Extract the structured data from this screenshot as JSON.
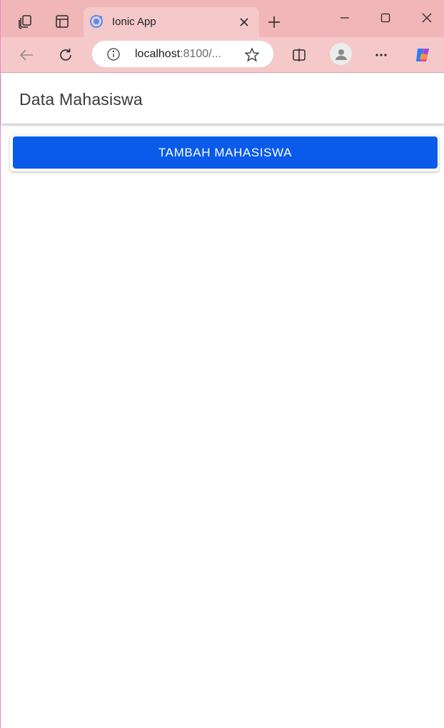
{
  "browser": {
    "tab": {
      "title": "Ionic App"
    },
    "address": {
      "host": "localhost",
      "rest": ":8100/..."
    },
    "icons": {
      "workspaces": "workspaces-icon",
      "tab_actions": "tab-actions-icon",
      "favicon": "ionic-favicon-icon",
      "close_tab": "close-icon",
      "new_tab": "plus-icon",
      "minimize": "minimize-icon",
      "maximize": "maximize-icon",
      "close_window": "close-icon",
      "back": "back-arrow-icon",
      "refresh": "refresh-icon",
      "info": "info-icon",
      "favorite": "star-icon",
      "split_screen": "split-screen-icon",
      "profile": "profile-icon",
      "more": "more-icon",
      "copilot": "copilot-icon"
    },
    "colors": {
      "tabstrip": "#f0b6b8",
      "toolbar": "#f5c8c9"
    }
  },
  "app": {
    "header": {
      "title": "Data Mahasiswa"
    },
    "add_button": {
      "label": "TAMBAH MAHASISWA"
    },
    "colors": {
      "primary": "#0a5bea"
    }
  }
}
